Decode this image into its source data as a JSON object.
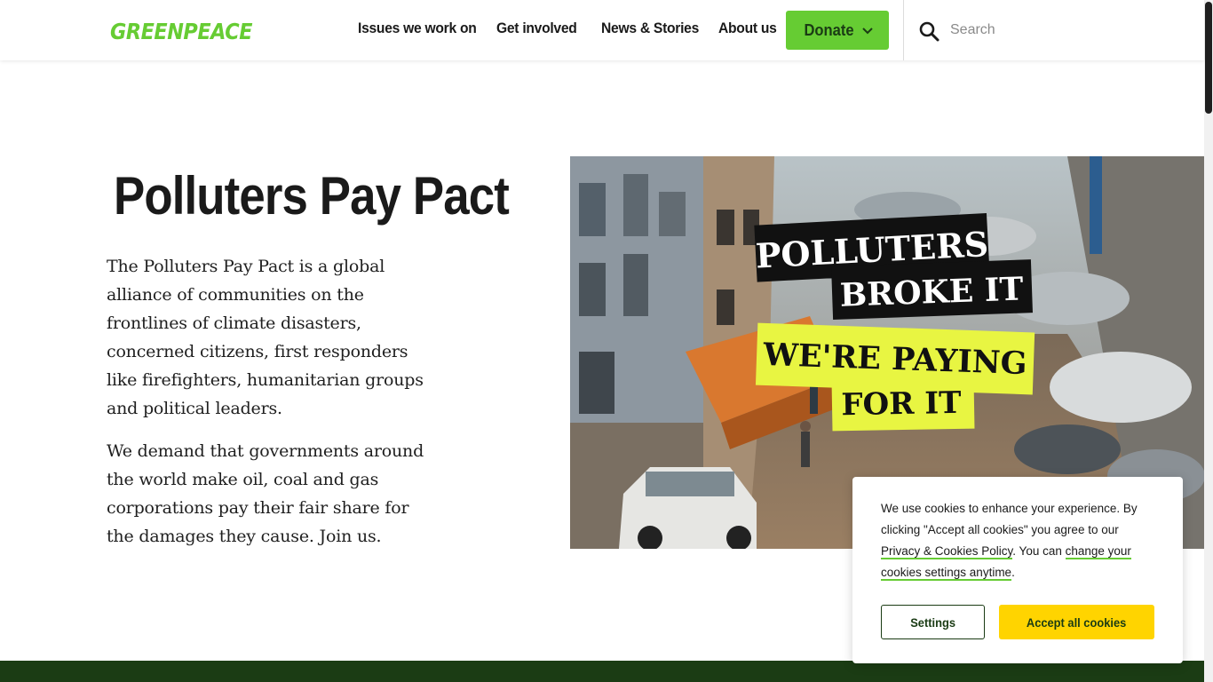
{
  "brand": {
    "name": "GREENPEACE",
    "color": "#66cc33",
    "dark_green": "#1b3c14"
  },
  "nav": {
    "items": [
      {
        "label": "Issues we work on"
      },
      {
        "label": "Get involved"
      },
      {
        "label": "News & Stories"
      },
      {
        "label": "About us"
      }
    ],
    "donate_label": "Donate",
    "donate_icon": "chevron-down-icon"
  },
  "search": {
    "placeholder": "Search",
    "icon": "search-icon"
  },
  "hero": {
    "title": "Polluters Pay Pact",
    "paragraphs": [
      "The Polluters Pay Pact is a global alliance of communities on the frontlines of climate disasters, concerned citizens, first responders like firefighters, humanitarian groups and political leaders.",
      "We demand that governments around the world make oil, coal and gas corporations pay their fair share for the damages they cause. Join us."
    ],
    "image": {
      "line1": "POLLUTERS",
      "line2": "BROKE IT",
      "line3": "WE'RE PAYING",
      "line4": "FOR IT",
      "highlight_color": "#e8f542"
    }
  },
  "cookie_banner": {
    "text_before": "We use cookies to enhance your experience. By clicking \"Accept all cookies\" you agree to our ",
    "policy_link": "Privacy & Cookies Policy",
    "text_middle": ". You can ",
    "settings_link": "change your cookies settings anytime",
    "text_after": ".",
    "settings_button": "Settings",
    "accept_button": "Accept all cookies",
    "accept_color": "#ffd400"
  }
}
